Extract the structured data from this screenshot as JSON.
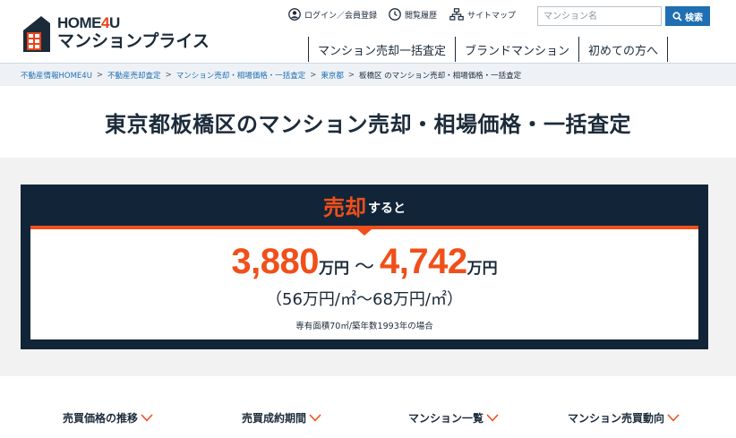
{
  "header": {
    "logo_en_prefix": "HOME",
    "logo_en_four": "4",
    "logo_en_suffix": "U",
    "logo_ja": "マンションプライス",
    "util_links": {
      "login": "ログイン／会員登録",
      "history": "閲覧履歴",
      "sitemap": "サイトマップ"
    },
    "search": {
      "placeholder": "マンション名",
      "button": "検索"
    },
    "nav": [
      "マンション売却一括査定",
      "ブランドマンション",
      "初めての方へ"
    ]
  },
  "breadcrumb": [
    "不動産情報HOME4U",
    "不動産売却査定",
    "マンション売却・相場価格・一括査定",
    "東京都",
    "板橋区 のマンション売却・相場価格・一括査定"
  ],
  "page_title": "東京都板橋区のマンション売却・相場価格・一括査定",
  "price": {
    "head_big": "売却",
    "head_small": "すると",
    "low": "3,880",
    "high": "4,742",
    "unit": "万円",
    "tilde": "～",
    "per_sqm": "（56万円/㎡～68万円/㎡）",
    "note": "専有面積70㎡/築年数1993年の場合"
  },
  "subnav": [
    "売買価格の推移",
    "売買成約期間",
    "マンション一覧",
    "マンション売買動向"
  ],
  "colors": {
    "accent": "#f14f1a",
    "navy": "#122538",
    "link": "#1f6fb2"
  }
}
